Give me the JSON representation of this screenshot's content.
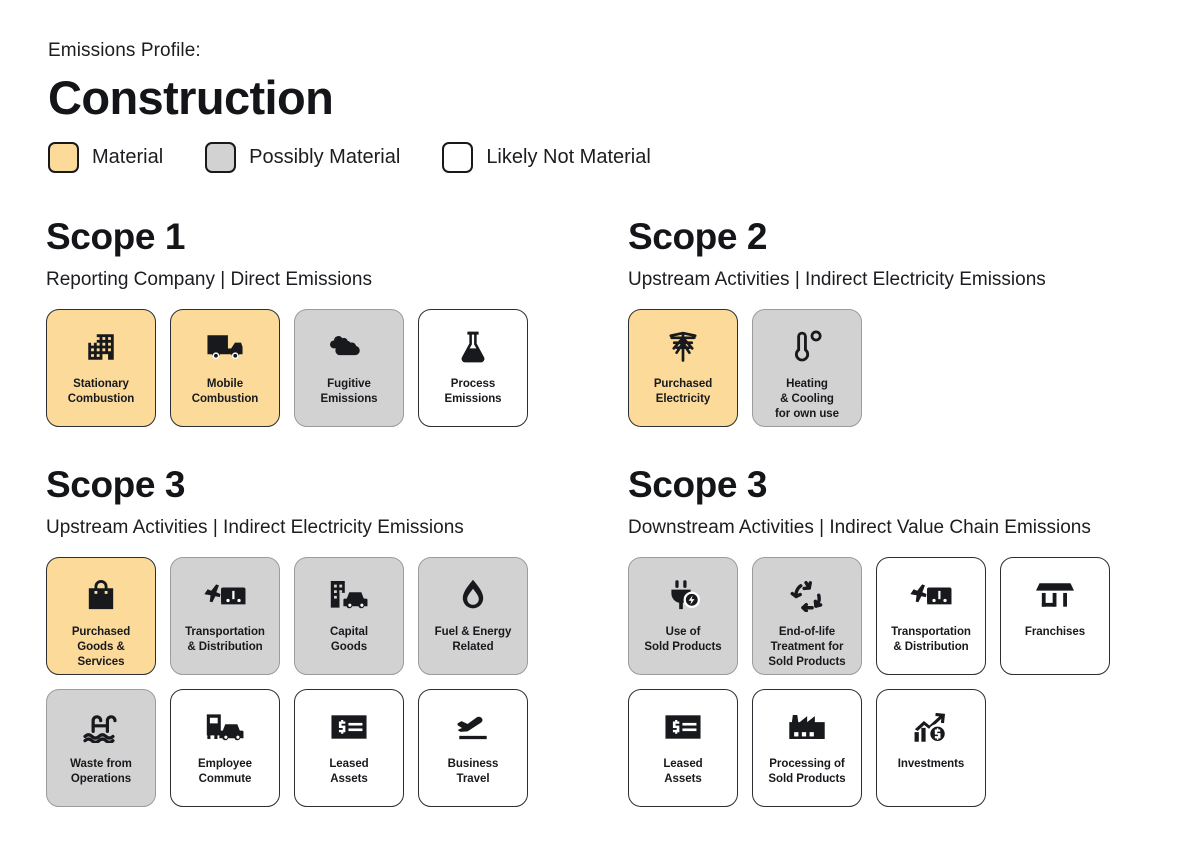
{
  "header": {
    "eyebrow": "Emissions Profile:",
    "title": "Construction"
  },
  "legend": {
    "items": [
      {
        "label": "Material",
        "key": "material",
        "color": "#fcda9a"
      },
      {
        "label": "Possibly Material",
        "key": "possibly",
        "color": "#d2d2d2"
      },
      {
        "label": "Likely Not Material",
        "key": "notmaterial",
        "color": "#ffffff"
      }
    ]
  },
  "colors": {
    "material": "#fcda9a",
    "possibly_material": "#d2d2d2",
    "likely_not_material": "#ffffff",
    "ink": "#17191c"
  },
  "sections": [
    {
      "id": "scope-1",
      "title": "Scope 1",
      "subtitle": "Reporting Company | Direct Emissions",
      "cards": [
        {
          "label": "Stationary\nCombustion",
          "status": "material",
          "icon": "building-icon"
        },
        {
          "label": "Mobile\nCombustion",
          "status": "material",
          "icon": "truck-icon"
        },
        {
          "label": "Fugitive\nEmissions",
          "status": "possibly",
          "icon": "cloud-icon"
        },
        {
          "label": "Process\nEmissions",
          "status": "notmaterial",
          "icon": "flask-icon"
        }
      ]
    },
    {
      "id": "scope-2",
      "title": "Scope 2",
      "subtitle": "Upstream Activities | Indirect Electricity Emissions",
      "cards": [
        {
          "label": "Purchased\nElectricity",
          "status": "material",
          "icon": "power-pylon-icon"
        },
        {
          "label": "Heating\n& Cooling\nfor own use",
          "status": "possibly",
          "icon": "thermometer-icon"
        }
      ]
    },
    {
      "id": "scope-3-upstream",
      "title": "Scope 3",
      "subtitle": "Upstream Activities | Indirect Electricity Emissions",
      "cards": [
        {
          "label": "Purchased\nGoods &\nServices",
          "status": "material",
          "icon": "shopping-bag-icon"
        },
        {
          "label": "Transportation\n& Distribution",
          "status": "possibly",
          "icon": "plane-truck-icon"
        },
        {
          "label": "Capital\nGoods",
          "status": "possibly",
          "icon": "building-car-icon"
        },
        {
          "label": "Fuel & Energy\nRelated",
          "status": "possibly",
          "icon": "droplet-icon"
        },
        {
          "label": "Waste from\nOperations",
          "status": "possibly",
          "icon": "water-waste-icon"
        },
        {
          "label": "Employee\nCommute",
          "status": "notmaterial",
          "icon": "bus-car-icon"
        },
        {
          "label": "Leased\nAssets",
          "status": "notmaterial",
          "icon": "money-note-icon"
        },
        {
          "label": "Business\nTravel",
          "status": "notmaterial",
          "icon": "airplane-icon"
        }
      ]
    },
    {
      "id": "scope-3-downstream",
      "title": "Scope 3",
      "subtitle": "Downstream Activities | Indirect Value Chain Emissions",
      "cards": [
        {
          "label": "Use of\nSold Products",
          "status": "possibly",
          "icon": "plug-bolt-icon"
        },
        {
          "label": "End-of-life\nTreatment for\nSold Products",
          "status": "possibly",
          "icon": "recycle-icon"
        },
        {
          "label": "Transportation\n& Distribution",
          "status": "notmaterial",
          "icon": "plane-truck-icon"
        },
        {
          "label": "Franchises",
          "status": "notmaterial",
          "icon": "storefront-icon"
        },
        {
          "label": "Leased\nAssets",
          "status": "notmaterial",
          "icon": "money-note-icon"
        },
        {
          "label": "Processing of\nSold Products",
          "status": "notmaterial",
          "icon": "factory-icon"
        },
        {
          "label": "Investments",
          "status": "notmaterial",
          "icon": "growth-chart-dollar-icon"
        }
      ]
    }
  ]
}
